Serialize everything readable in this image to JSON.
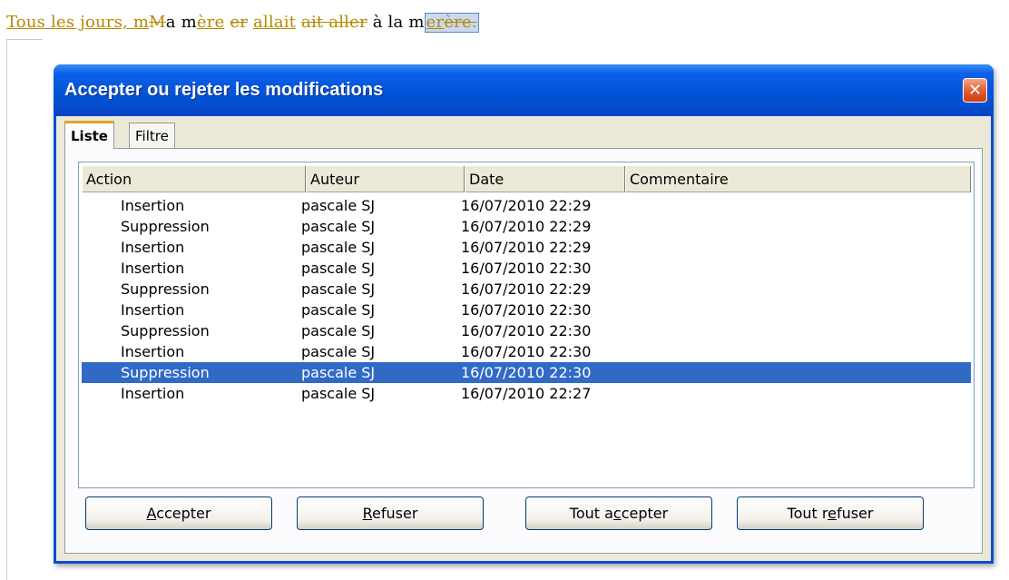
{
  "document": {
    "segments": [
      {
        "text": "Tous les jours, m",
        "style": "ins"
      },
      {
        "text": "M",
        "style": "del"
      },
      {
        "text": "a m",
        "style": "normal"
      },
      {
        "text": "ère",
        "style": "ins"
      },
      {
        "text": " ",
        "style": "normal"
      },
      {
        "text": "er",
        "style": "del"
      },
      {
        "text": " ",
        "style": "normal"
      },
      {
        "text": "allait",
        "style": "ins"
      },
      {
        "text": " ",
        "style": "normal"
      },
      {
        "text": "ait aller",
        "style": "del"
      },
      {
        "text": " à la m",
        "style": "normal"
      },
      {
        "text": "er",
        "style": "ins-sel"
      },
      {
        "text": "ère.",
        "style": "del-sel"
      }
    ]
  },
  "dialog": {
    "title": "Accepter ou rejeter les modifications",
    "close_glyph": "✕",
    "tabs": [
      {
        "label": "Liste",
        "active": true
      },
      {
        "label": "Filtre",
        "active": false
      }
    ],
    "columns": [
      "Action",
      "Auteur",
      "Date",
      "Commentaire"
    ],
    "rows": [
      {
        "action": "Insertion",
        "author": "pascale SJ",
        "date": "16/07/2010 22:29",
        "comment": "",
        "selected": false
      },
      {
        "action": "Suppression",
        "author": "pascale SJ",
        "date": "16/07/2010 22:29",
        "comment": "",
        "selected": false
      },
      {
        "action": "Insertion",
        "author": "pascale SJ",
        "date": "16/07/2010 22:29",
        "comment": "",
        "selected": false
      },
      {
        "action": "Insertion",
        "author": "pascale SJ",
        "date": "16/07/2010 22:30",
        "comment": "",
        "selected": false
      },
      {
        "action": "Suppression",
        "author": "pascale SJ",
        "date": "16/07/2010 22:29",
        "comment": "",
        "selected": false
      },
      {
        "action": "Insertion",
        "author": "pascale SJ",
        "date": "16/07/2010 22:30",
        "comment": "",
        "selected": false
      },
      {
        "action": "Suppression",
        "author": "pascale SJ",
        "date": "16/07/2010 22:30",
        "comment": "",
        "selected": false
      },
      {
        "action": "Insertion",
        "author": "pascale SJ",
        "date": "16/07/2010 22:30",
        "comment": "",
        "selected": false
      },
      {
        "action": "Suppression",
        "author": "pascale SJ",
        "date": "16/07/2010 22:30",
        "comment": "",
        "selected": true
      },
      {
        "action": "Insertion",
        "author": "pascale SJ",
        "date": "16/07/2010 22:27",
        "comment": "",
        "selected": false
      }
    ],
    "buttons": {
      "accept": {
        "pre": "",
        "mnemonic": "A",
        "post": "ccepter"
      },
      "reject": {
        "pre": "",
        "mnemonic": "R",
        "post": "efuser"
      },
      "accept_all": {
        "pre": "Tout a",
        "mnemonic": "c",
        "post": "cepter"
      },
      "reject_all": {
        "pre": "Tout r",
        "mnemonic": "e",
        "post": "fuser"
      }
    }
  },
  "colors": {
    "tracked_change": "#b58900",
    "selection": "#316ac5",
    "titlebar": "#0452d6",
    "close_button": "#e15a2a"
  }
}
